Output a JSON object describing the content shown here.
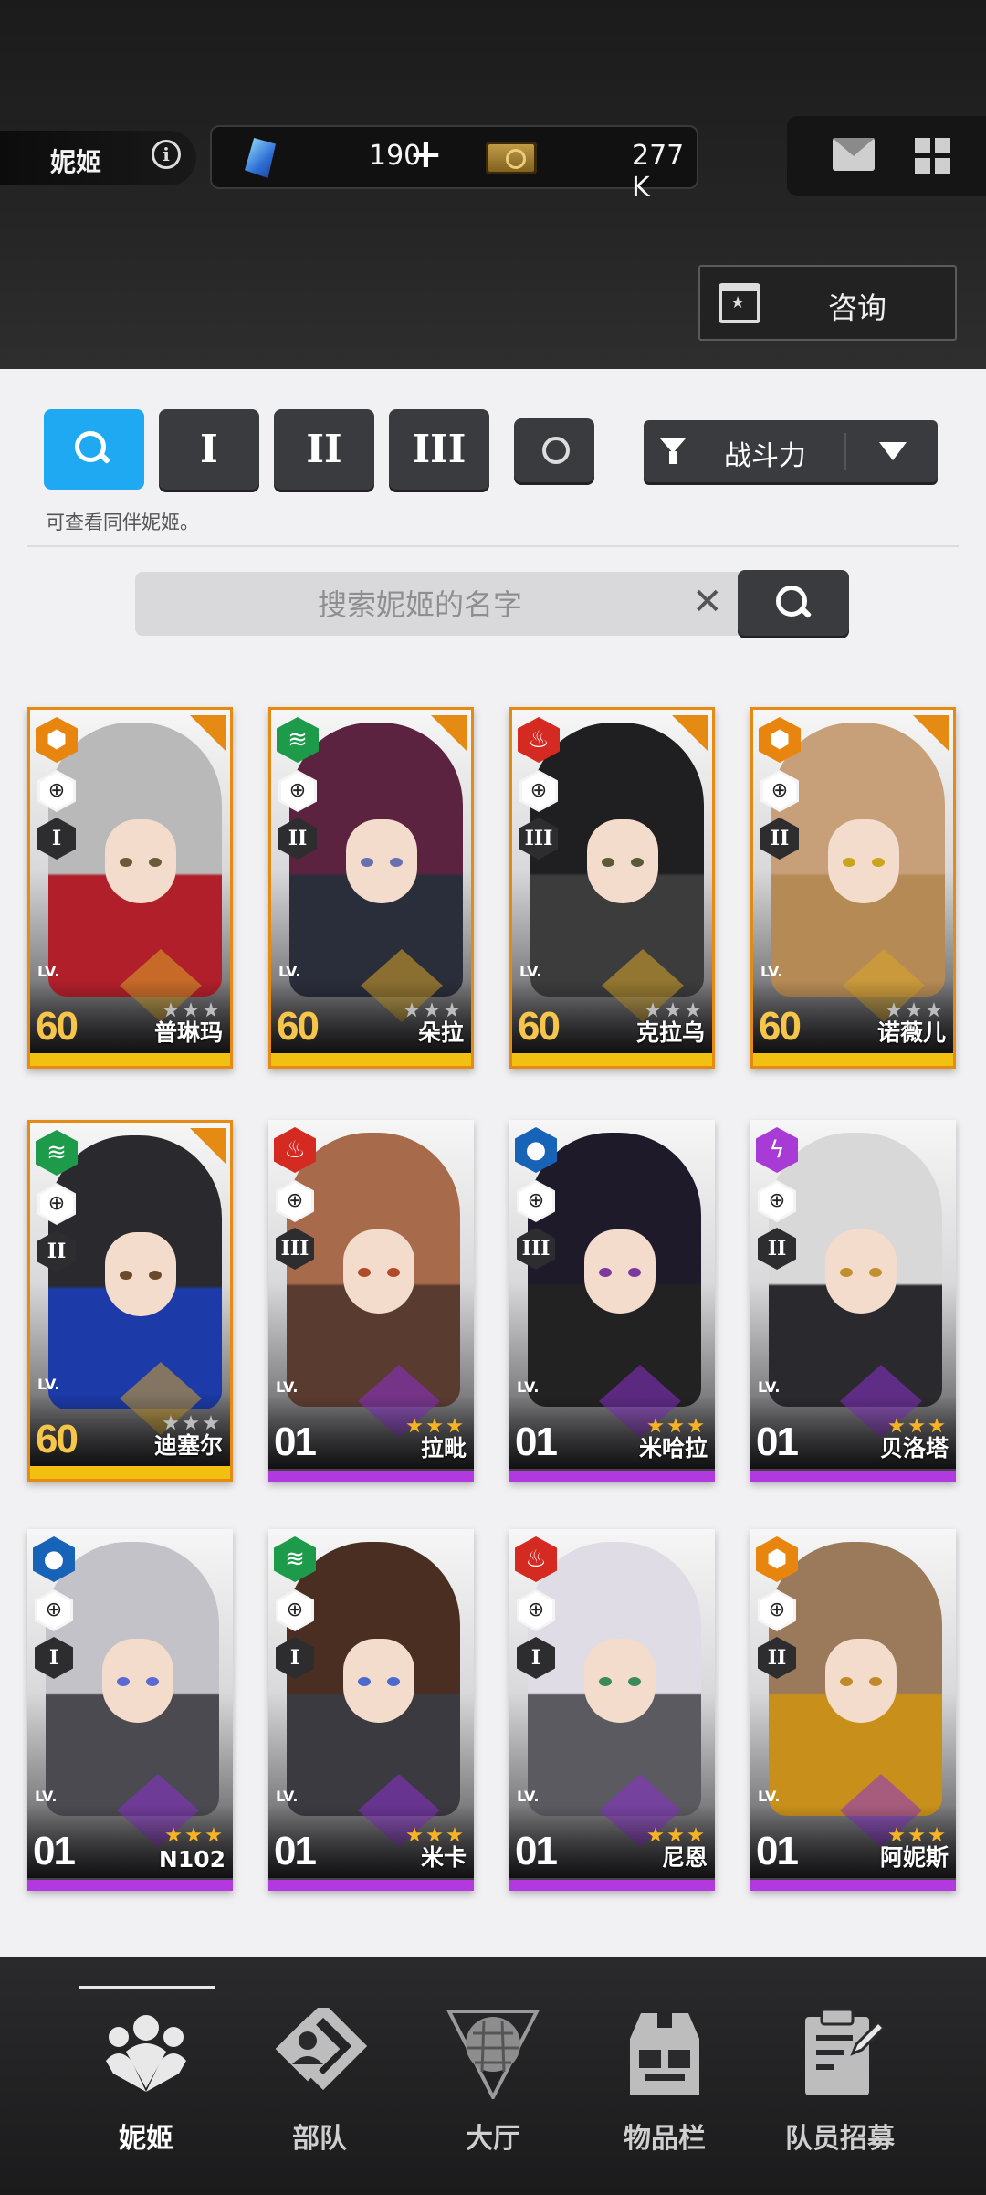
{
  "header": {
    "title": "妮姬",
    "gems": "190",
    "gems_plus": "+",
    "credits": "277 K",
    "consult_label": "咨询"
  },
  "filters": {
    "burst_labels": [
      "I",
      "II",
      "III"
    ],
    "sort_label": "战斗力",
    "hint": "可查看同伴妮姬。"
  },
  "search": {
    "placeholder": "搜索妮姬的名字",
    "clear": "✕"
  },
  "cards": [
    {
      "name": "普琳玛",
      "lv_label": "LV.",
      "level": "60",
      "burst": "I",
      "element_color": "#e8850f",
      "element_glyph": "⬢",
      "rarity": "gold",
      "hair": "#b9b9b9",
      "coat": "#b01f2a",
      "eye": "#6b5a3a"
    },
    {
      "name": "朵拉",
      "lv_label": "LV.",
      "level": "60",
      "burst": "II",
      "element_color": "#1e9b4a",
      "element_glyph": "≋",
      "rarity": "gold",
      "hair": "#5b2340",
      "coat": "#2a2e3a",
      "eye": "#6a6fb0"
    },
    {
      "name": "克拉乌",
      "lv_label": "LV.",
      "level": "60",
      "burst": "III",
      "element_color": "#d42a22",
      "element_glyph": "♨",
      "rarity": "gold",
      "hair": "#1f1f22",
      "coat": "#3c3c3c",
      "eye": "#5a5a38"
    },
    {
      "name": "诺薇儿",
      "lv_label": "LV.",
      "level": "60",
      "burst": "II",
      "element_color": "#e8850f",
      "element_glyph": "⬢",
      "rarity": "gold",
      "hair": "#c7a07a",
      "coat": "#b58a55",
      "eye": "#c8a51a"
    },
    {
      "name": "迪塞尔",
      "lv_label": "LV.",
      "level": "60",
      "burst": "II",
      "element_color": "#1e9b4a",
      "element_glyph": "≋",
      "rarity": "gold",
      "hair": "#2a2a2e",
      "coat": "#1c3aa8",
      "eye": "#6a4a2a"
    },
    {
      "name": "拉毗",
      "lv_label": "LV.",
      "level": "01",
      "burst": "III",
      "element_color": "#d42a22",
      "element_glyph": "♨",
      "rarity": "purple",
      "hair": "#a76a4a",
      "coat": "#5a3b30",
      "eye": "#b04a2a"
    },
    {
      "name": "米哈拉",
      "lv_label": "LV.",
      "level": "01",
      "burst": "III",
      "element_color": "#1763b8",
      "element_glyph": "●",
      "rarity": "purple",
      "hair": "#1e1a2a",
      "coat": "#222",
      "eye": "#7a3aa0"
    },
    {
      "name": "贝洛塔",
      "lv_label": "LV.",
      "level": "01",
      "burst": "II",
      "element_color": "#a83bd6",
      "element_glyph": "ϟ",
      "rarity": "purple",
      "hair": "#d8d8d8",
      "coat": "#2a2a2e",
      "eye": "#c09030"
    },
    {
      "name": "N102",
      "lv_label": "LV.",
      "level": "01",
      "burst": "I",
      "element_color": "#1763b8",
      "element_glyph": "●",
      "rarity": "purple",
      "hair": "#c2c2c8",
      "coat": "#4a4a50",
      "eye": "#5a6ad0"
    },
    {
      "name": "米卡",
      "lv_label": "LV.",
      "level": "01",
      "burst": "I",
      "element_color": "#1e9b4a",
      "element_glyph": "≋",
      "rarity": "purple",
      "hair": "#4a2e22",
      "coat": "#3a3a40",
      "eye": "#4a6ad0"
    },
    {
      "name": "尼恩",
      "lv_label": "LV.",
      "level": "01",
      "burst": "I",
      "element_color": "#d42a22",
      "element_glyph": "♨",
      "rarity": "purple",
      "hair": "#e0dce6",
      "coat": "#5a5a60",
      "eye": "#3a8a5a"
    },
    {
      "name": "阿妮斯",
      "lv_label": "LV.",
      "level": "01",
      "burst": "II",
      "element_color": "#e8850f",
      "element_glyph": "⬢",
      "rarity": "purple",
      "hair": "#9a7a5a",
      "coat": "#c8901a",
      "eye": "#c08a2a"
    }
  ],
  "nav": {
    "items": [
      "妮姬",
      "部队",
      "大厅",
      "物品栏",
      "队员招募"
    ],
    "active_index": 0
  }
}
